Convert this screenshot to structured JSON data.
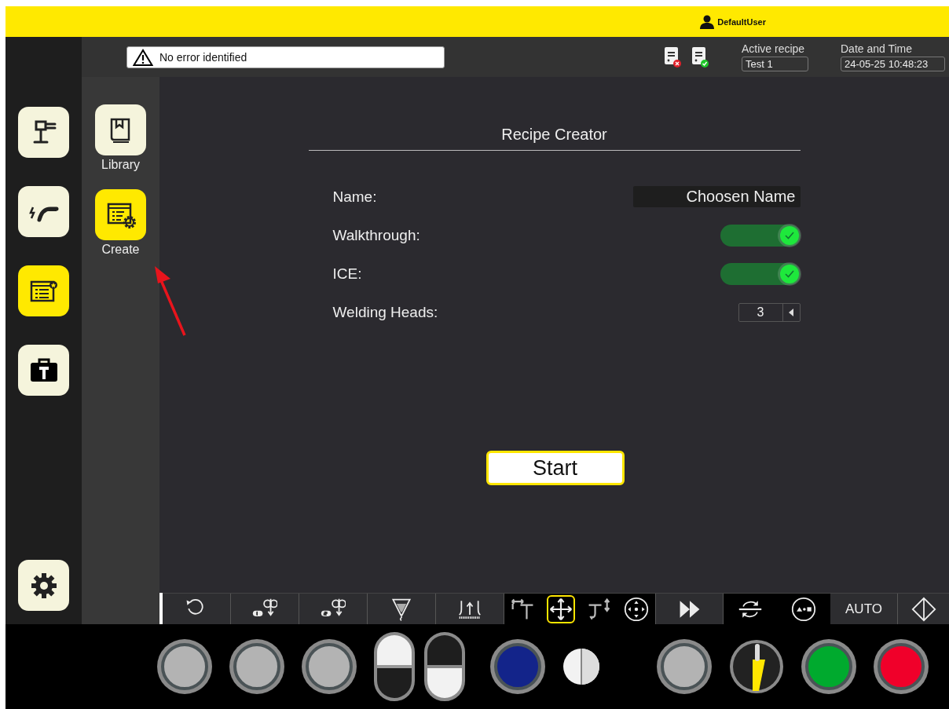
{
  "top_bar": {
    "user": "DefaultUser"
  },
  "header": {
    "status": {
      "message": "No error identified"
    },
    "active_recipe": {
      "label": "Active recipe",
      "value": "Test 1"
    },
    "date_time": {
      "label": "Date and Time",
      "value": "24-05-25 10:48:23"
    }
  },
  "nav": {
    "items": [
      {
        "kind": "station",
        "selected": false
      },
      {
        "kind": "torch",
        "selected": false
      },
      {
        "kind": "recipe",
        "selected": true
      },
      {
        "kind": "toolbox",
        "selected": false
      }
    ],
    "settings": {
      "kind": "settings",
      "selected": false
    }
  },
  "submenu": {
    "items": [
      {
        "kind": "library",
        "label": "Library",
        "selected": false
      },
      {
        "kind": "create",
        "label": "Create",
        "selected": true
      }
    ]
  },
  "recipe_creator": {
    "title": "Recipe Creator",
    "fields": [
      {
        "kind": "text",
        "label": "Name:",
        "value": "Choosen Name"
      },
      {
        "kind": "switch",
        "label": "Walkthrough:",
        "on": true
      },
      {
        "kind": "switch",
        "label": "ICE:",
        "on": true
      },
      {
        "kind": "spinner",
        "label": "Welding Heads:",
        "value": "3"
      }
    ],
    "start_button": "Start"
  },
  "toolbar": [
    {
      "kind": "reset",
      "selected": false
    },
    {
      "kind": "head1",
      "selected": false
    },
    {
      "kind": "head2",
      "selected": false
    },
    {
      "kind": "funnel",
      "selected": false
    },
    {
      "kind": "seam",
      "selected": false
    },
    {
      "kind": "move-h",
      "selected": false
    },
    {
      "kind": "move-all",
      "selected": true
    },
    {
      "kind": "move-v",
      "selected": false
    },
    {
      "kind": "joystick",
      "selected": false
    },
    {
      "kind": "fast-forward",
      "selected": false
    },
    {
      "kind": "rotate",
      "selected": false
    },
    {
      "kind": "position",
      "selected": false
    },
    {
      "kind": "auto",
      "label": "AUTO",
      "selected": false
    },
    {
      "kind": "diamond",
      "selected": false
    }
  ],
  "control_panel": [
    {
      "kind": "round",
      "color": "#b3b3b3"
    },
    {
      "kind": "round",
      "color": "#b3b3b3"
    },
    {
      "kind": "round",
      "color": "#b3b3b3"
    },
    {
      "kind": "rocker",
      "on": true
    },
    {
      "kind": "rocker",
      "on": false
    },
    {
      "kind": "round",
      "color": "#13248a"
    },
    {
      "kind": "indicator"
    },
    {
      "kind": "round",
      "color": "#b3b3b3"
    },
    {
      "kind": "key",
      "on": false
    },
    {
      "kind": "round",
      "color": "#00aa2e"
    },
    {
      "kind": "round",
      "color": "#f0002a"
    }
  ]
}
